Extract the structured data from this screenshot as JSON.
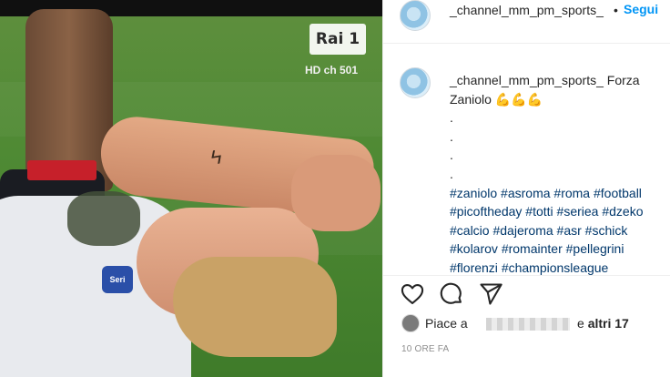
{
  "overlay": {
    "channel_logo": "Rai 1",
    "channel_text": "HD ch 501",
    "badge_text": "Seri"
  },
  "header": {
    "username": "_channel_mm_pm_sports_",
    "separator": "•",
    "follow_label": "Segui"
  },
  "caption": {
    "username": "_channel_mm_pm_sports_",
    "text": "Forza Zaniolo",
    "emojis": "💪💪💪",
    "dots": [
      ".",
      ".",
      ".",
      "."
    ],
    "hashtags": [
      "#zaniolo",
      "#asroma",
      "#roma",
      "#football",
      "#picoftheday",
      "#totti",
      "#seriea",
      "#dzeko",
      "#calcio",
      "#dajeroma",
      "#asr",
      "#schick",
      "#kolarov",
      "#romainter",
      "#pellegrini",
      "#florenzi",
      "#championsleague"
    ]
  },
  "likes": {
    "prefix": "Piace a",
    "suffix_pre": "e",
    "suffix_bold": "altri 17"
  },
  "timestamp": "10 ORE FA",
  "icons": {
    "like": "heart-icon",
    "comment": "comment-bubble-icon",
    "share": "paper-plane-icon"
  },
  "colors": {
    "follow": "#0095f6",
    "hashtag": "#00376b",
    "text": "#262626",
    "muted": "#8e8e8e"
  }
}
